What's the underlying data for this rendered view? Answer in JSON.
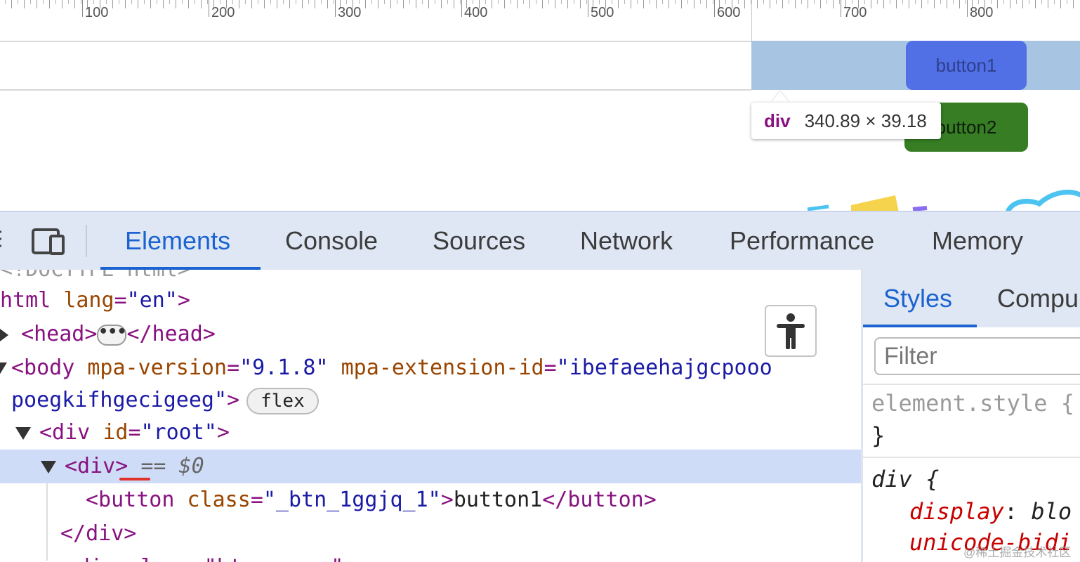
{
  "preview": {
    "ruler_ticks": [
      "100",
      "200",
      "300",
      "400",
      "500",
      "600",
      "700",
      "800"
    ],
    "button1_label": "button1",
    "button2_label": "button2",
    "tooltip": {
      "tag": "div",
      "size": "340.89 × 39.18"
    }
  },
  "devtools": {
    "tabs": [
      "Elements",
      "Console",
      "Sources",
      "Network",
      "Performance",
      "Memory"
    ],
    "active_tab": "Elements",
    "dom": {
      "line0": "<!DOCTYPE html>",
      "html_open_tag": "html",
      "html_attr": "lang",
      "html_val": "\"en\"",
      "head_open": "<head>",
      "head_close": "</head>",
      "ellipsis": "•••",
      "body_tag": "<body",
      "body_attr1": "mpa-version",
      "body_val1": "\"9.1.8\"",
      "body_attr2": "mpa-extension-id",
      "body_val2a": "\"ibefaeehajgcpooo",
      "body_val2b": "poegkifhgecigeeg\"",
      "body_close": ">",
      "flex_badge": "flex",
      "div_root_tag": "<div",
      "div_root_attr": "id",
      "div_root_val": "\"root\"",
      "div_tag": "<div>",
      "selected_marker": "== $0",
      "button_tag": "<button",
      "button_attr": "class",
      "button_val": "\"_btn_1ggjq_1\"",
      "button_text": "button1",
      "button_close": "</button>",
      "div_close": "</div>",
      "next_line": "<div class=\"btn-group\""
    },
    "styles": {
      "tabs": [
        "Styles",
        "Compu"
      ],
      "filter_placeholder": "Filter",
      "element_style": "element.style {",
      "close_brace": "}",
      "div_selector": "div {",
      "prop1": "display",
      "prop1_value": "blo",
      "prop2": "unicode-bidi"
    }
  },
  "watermark": "@稀土掘金技术社区"
}
